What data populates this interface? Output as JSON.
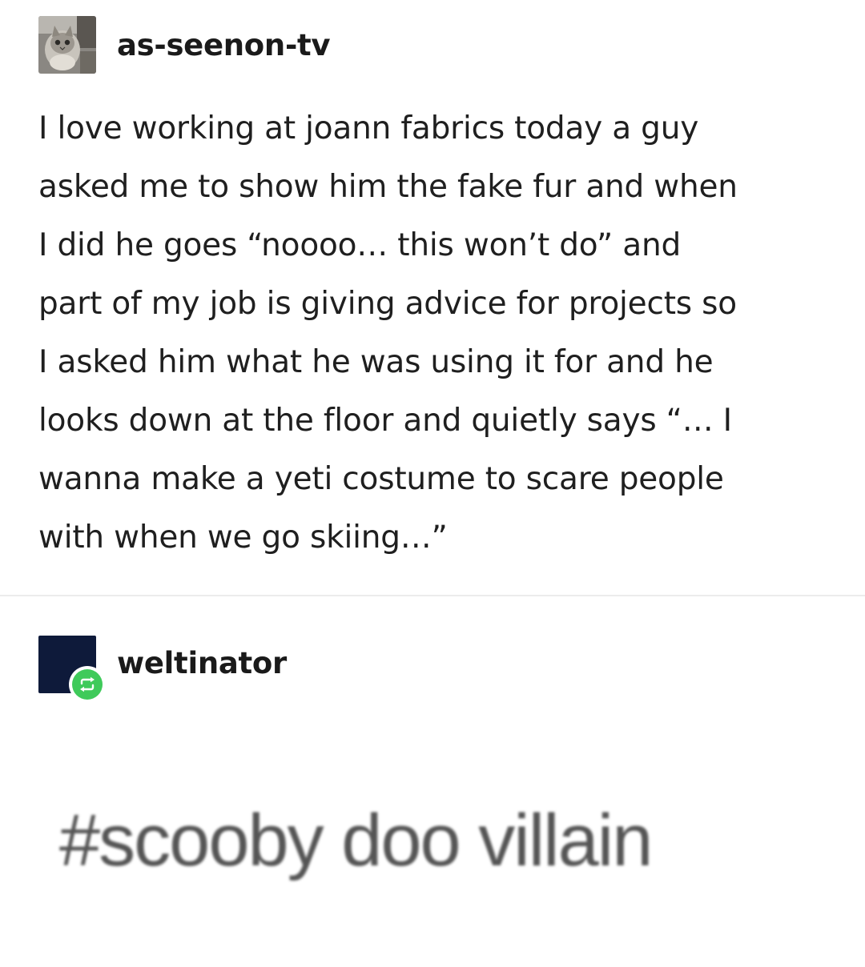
{
  "post": {
    "author": {
      "username": "as-seenon-tv",
      "avatar_icon": "cat-photo-avatar"
    },
    "body_lines": [
      "I love working at joann fabrics today a guy",
      "asked me to show him the fake fur and when",
      "I did he goes “noooo… this won’t do” and",
      "part of my job is giving advice for projects so",
      "I asked him what he was using it for and he",
      "looks down at the floor and quietly says “… I",
      "wanna make a yeti costume to scare people",
      "with when we go skiing…”"
    ]
  },
  "reblog": {
    "username": "weltinator",
    "avatar_icon": "navy-square-avatar",
    "badge_icon": "reblog-icon",
    "badge_color": "#3fca5a",
    "tag": "#scooby doo villain"
  }
}
